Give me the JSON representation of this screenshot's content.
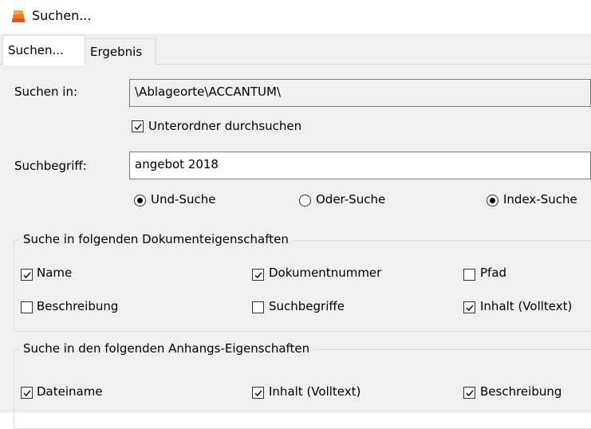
{
  "window": {
    "title": "Suchen..."
  },
  "tabs": [
    {
      "label": "Suchen...",
      "active": true
    },
    {
      "label": "Ergebnis",
      "active": false
    }
  ],
  "search_in": {
    "label": "Suchen in:",
    "value": "\\Ablageorte\\ACCANTUM\\"
  },
  "subfolders": {
    "label": "Unterordner durchsuchen",
    "checked": true
  },
  "search_term": {
    "label": "Suchbegriff:",
    "value": "angebot 2018"
  },
  "search_modes": [
    {
      "label": "Und-Suche",
      "selected": true
    },
    {
      "label": "Oder-Suche",
      "selected": false
    },
    {
      "label": "Index-Suche",
      "selected": true
    }
  ],
  "doc_properties": {
    "title": "Suche in folgenden Dokumenteigenschaften",
    "items": [
      {
        "label": "Name",
        "checked": true
      },
      {
        "label": "Dokumentnummer",
        "checked": true
      },
      {
        "label": "Pfad",
        "checked": false
      },
      {
        "label": "Beschreibung",
        "checked": false
      },
      {
        "label": "Suchbegriffe",
        "checked": false
      },
      {
        "label": "Inhalt (Volltext)",
        "checked": true
      }
    ]
  },
  "attachment_properties": {
    "title": "Suche in den folgenden Anhangs-Eigenschaften",
    "items": [
      {
        "label": "Dateiname",
        "checked": true
      },
      {
        "label": "Inhalt (Volltext)",
        "checked": true
      },
      {
        "label": "Beschreibung",
        "checked": true
      }
    ]
  }
}
